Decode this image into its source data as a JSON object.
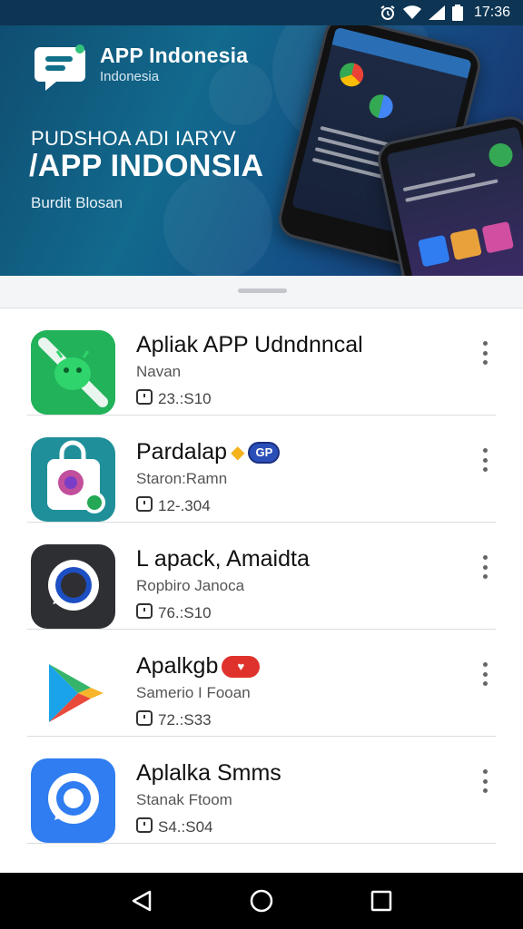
{
  "status_bar": {
    "time": "17:36",
    "icons": [
      "alarm-icon",
      "wifi-icon",
      "signal-icon",
      "battery-icon"
    ]
  },
  "banner": {
    "brand_title": "APP Indonesia",
    "brand_subtitle": "Indonesia",
    "line1": "PUDSHOA ADI IARYV",
    "line2": "/APP INDONSIA",
    "line3": "Burdit Blosan"
  },
  "apps": [
    {
      "name": "Apliak APP Udndnncal",
      "developer": "Navan",
      "meta": "23.:S10",
      "icon": "android-icon",
      "colors": {
        "bg": "#1faa4e"
      }
    },
    {
      "name": "Pardalap",
      "developer": "Staron:Ramn",
      "meta": "12-.304",
      "icon": "shopping-bag-icon",
      "badge": "GP",
      "colors": {
        "bg": "#1f8f9a"
      }
    },
    {
      "name": "L apack, Amaidta",
      "developer": "Ropbiro Janoca",
      "meta": "76.:S10",
      "icon": "chat-bubble-icon",
      "colors": {
        "bg": "#2d2f33"
      }
    },
    {
      "name": "Apalkgb",
      "developer": "Samerio I Fooan",
      "meta": "72.:S33",
      "icon": "play-store-icon",
      "badge": "♥",
      "colors": {
        "bg": "#ffffff"
      }
    },
    {
      "name": "Aplalka Smms",
      "developer": "Stanak Ftoom",
      "meta": "S4.:S04",
      "icon": "messenger-icon",
      "colors": {
        "bg": "#2f7df0"
      }
    }
  ],
  "nav": {
    "back": "back-icon",
    "home": "home-icon",
    "recents": "recents-icon"
  }
}
